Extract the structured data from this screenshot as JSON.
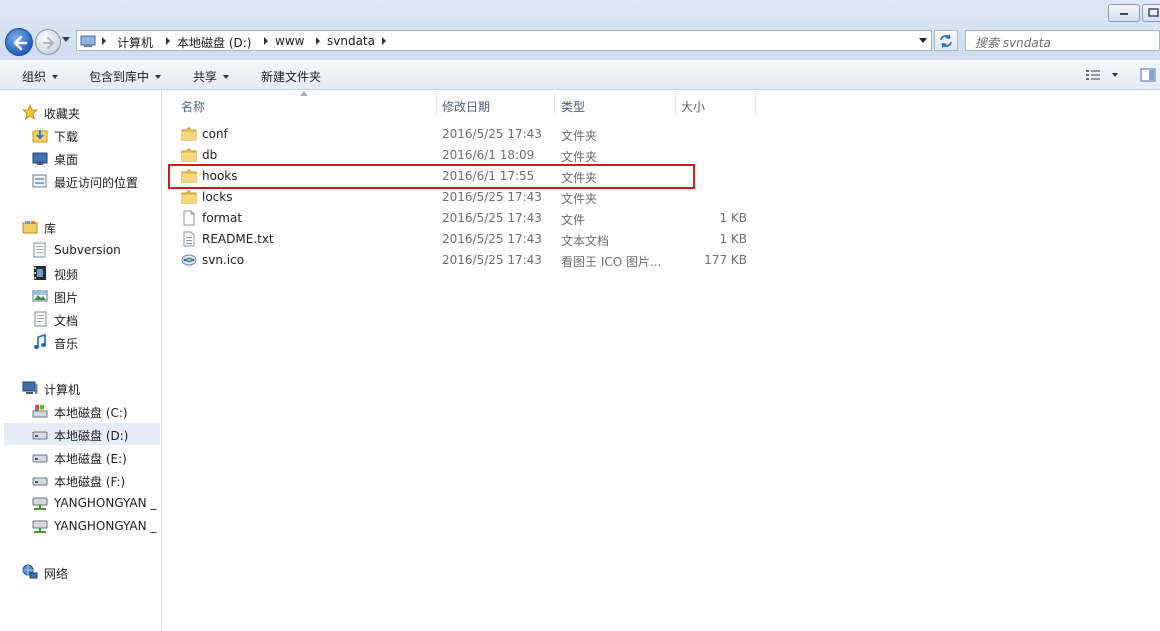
{
  "breadcrumb": [
    "计算机",
    "本地磁盘 (D:)",
    "www",
    "svndata"
  ],
  "search": {
    "placeholder": "搜索 svndata"
  },
  "toolbar": {
    "organize": "组织",
    "include_in_library": "包含到库中",
    "share": "共享",
    "new_folder": "新建文件夹"
  },
  "nav": {
    "favorites": {
      "label": "收藏夹",
      "items": [
        "下载",
        "桌面",
        "最近访问的位置"
      ]
    },
    "libraries": {
      "label": "库",
      "items": [
        "Subversion",
        "视频",
        "图片",
        "文档",
        "音乐"
      ]
    },
    "computer": {
      "label": "计算机",
      "items": [
        "本地磁盘 (C:)",
        "本地磁盘 (D:)",
        "本地磁盘 (E:)",
        "本地磁盘 (F:)",
        "YANGHONGYAN _",
        "YANGHONGYAN _"
      ],
      "selected": "本地磁盘 (D:)"
    },
    "network": {
      "label": "网络"
    }
  },
  "columns": {
    "name": "名称",
    "modified": "修改日期",
    "type": "类型",
    "size": "大小"
  },
  "files": [
    {
      "name": "conf",
      "modified": "2016/5/25 17:43",
      "type": "文件夹",
      "size": "",
      "icon": "folder-icon"
    },
    {
      "name": "db",
      "modified": "2016/6/1 18:09",
      "type": "文件夹",
      "size": "",
      "icon": "folder-icon"
    },
    {
      "name": "hooks",
      "modified": "2016/6/1 17:55",
      "type": "文件夹",
      "size": "",
      "icon": "folder-icon",
      "highlighted": true
    },
    {
      "name": "locks",
      "modified": "2016/5/25 17:43",
      "type": "文件夹",
      "size": "",
      "icon": "folder-icon"
    },
    {
      "name": "format",
      "modified": "2016/5/25 17:43",
      "type": "文件",
      "size": "1 KB",
      "icon": "file-icon"
    },
    {
      "name": "README.txt",
      "modified": "2016/5/25 17:43",
      "type": "文本文档",
      "size": "1 KB",
      "icon": "text-file-icon"
    },
    {
      "name": "svn.ico",
      "modified": "2016/5/25 17:43",
      "type": "看图王 ICO 图片...",
      "size": "177 KB",
      "icon": "ico-file-icon"
    }
  ],
  "colors": {
    "highlight_border": "#d11a1a",
    "selected_nav": "#e5eef8",
    "titlebar": "#dfe9f5"
  }
}
